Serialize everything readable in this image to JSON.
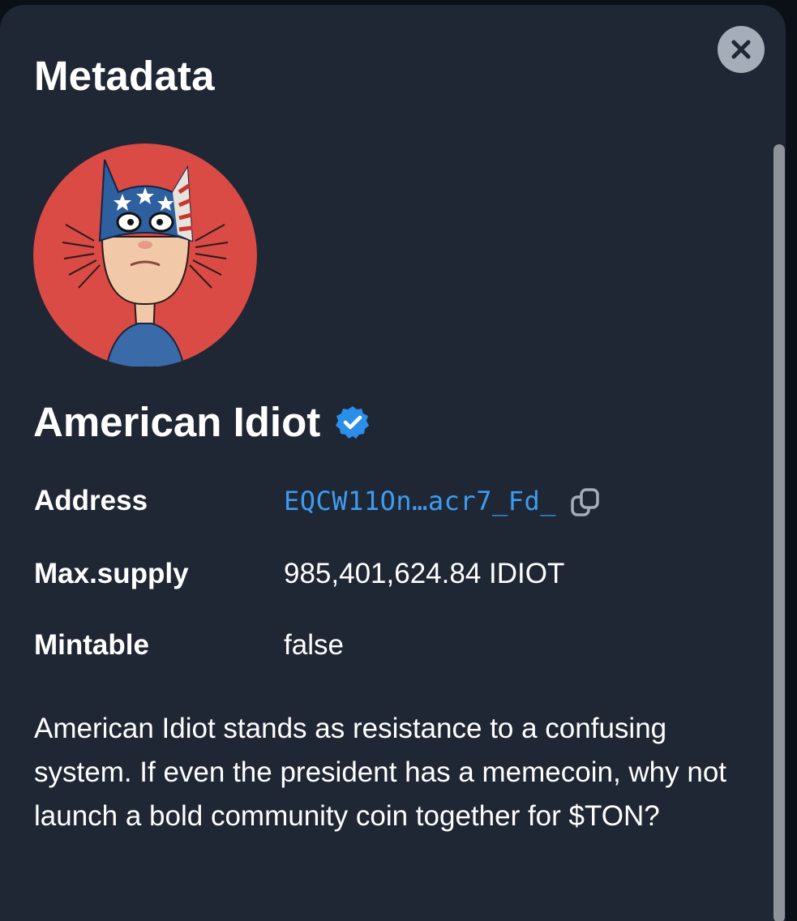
{
  "header": {
    "title": "Metadata",
    "close_icon": "close-icon"
  },
  "token": {
    "avatar_icon": "american-idiot-avatar",
    "avatar_bg": "#d94b44",
    "name": "American Idiot",
    "verified_icon": "verified-badge-icon",
    "verified_color": "#2b8ee8"
  },
  "details": {
    "address_label": "Address",
    "address_value": "EQCW11On…acr7_Fd_",
    "copy_icon": "copy-icon",
    "supply_label": "Max.supply",
    "supply_value": "985,401,624.84 IDIOT",
    "mintable_label": "Mintable",
    "mintable_value": "false"
  },
  "description": "American Idiot stands as resistance to a confusing system. If even the president has a memecoin, why not launch a bold community coin together for $TON?",
  "colors": {
    "panel_bg": "#1f2634",
    "link": "#3d9cf0",
    "close_bg": "#a5adb9"
  }
}
